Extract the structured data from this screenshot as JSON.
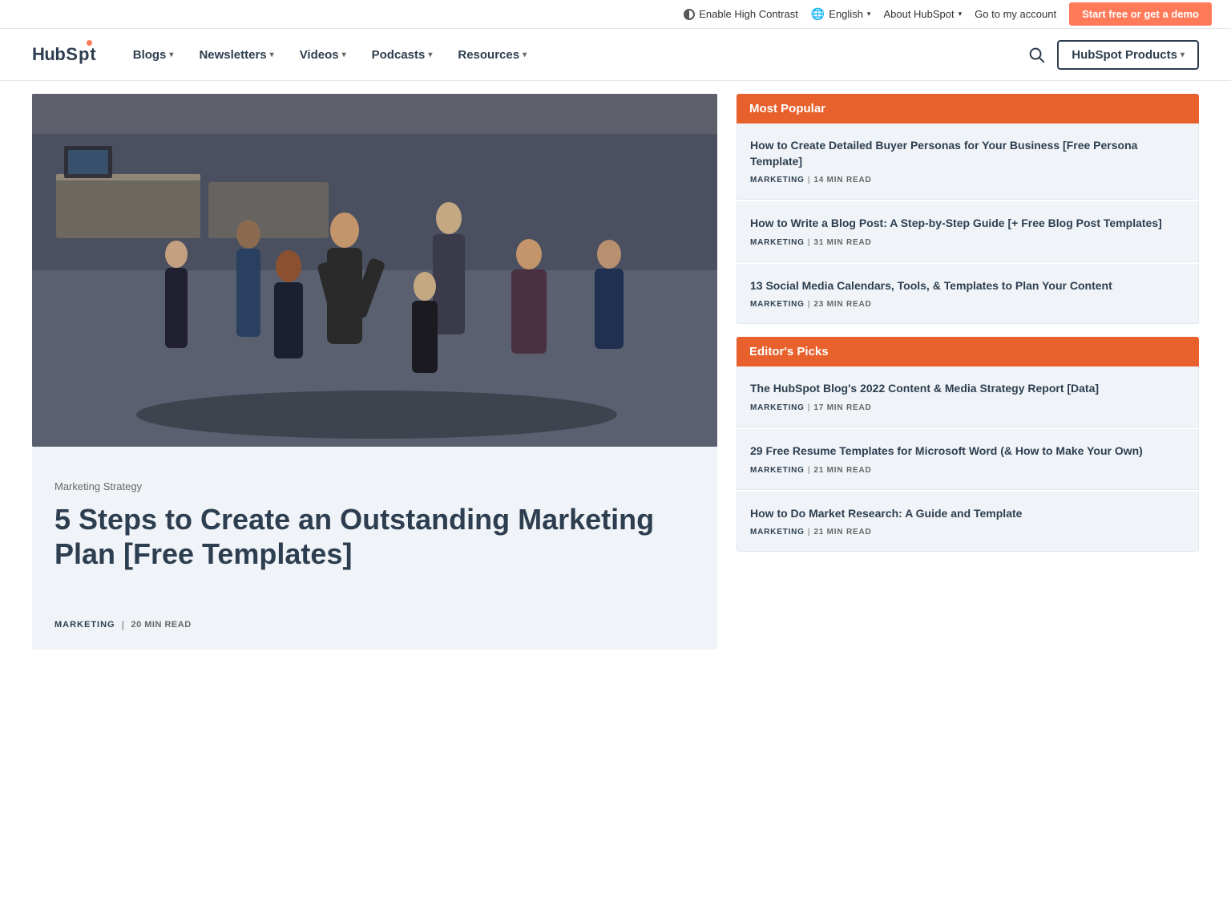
{
  "topbar": {
    "contrast_label": "Enable High Contrast",
    "language_label": "English",
    "about_label": "About HubSpot",
    "account_label": "Go to my account",
    "cta_label": "Start free or get a demo"
  },
  "nav": {
    "logo_text": "HubSpot",
    "links": [
      {
        "label": "Blogs",
        "has_dropdown": true
      },
      {
        "label": "Newsletters",
        "has_dropdown": true
      },
      {
        "label": "Videos",
        "has_dropdown": true
      },
      {
        "label": "Podcasts",
        "has_dropdown": true
      },
      {
        "label": "Resources",
        "has_dropdown": true
      }
    ],
    "search_label": "Search",
    "products_label": "HubSpot Products"
  },
  "article": {
    "category": "Marketing Strategy",
    "title": "5 Steps to Create an Outstanding Marketing Plan [Free Templates]",
    "meta_tag": "MARKETING",
    "meta_read": "20 MIN READ"
  },
  "sidebar": {
    "most_popular": {
      "header": "Most Popular",
      "items": [
        {
          "title": "How to Create Detailed Buyer Personas for Your Business [Free Persona Template]",
          "tag": "MARKETING",
          "read": "14 MIN READ"
        },
        {
          "title": "How to Write a Blog Post: A Step-by-Step Guide [+ Free Blog Post Templates]",
          "tag": "MARKETING",
          "read": "31 MIN READ"
        },
        {
          "title": "13 Social Media Calendars, Tools, & Templates to Plan Your Content",
          "tag": "MARKETING",
          "read": "23 MIN READ"
        }
      ]
    },
    "editors_picks": {
      "header": "Editor's Picks",
      "items": [
        {
          "title": "The HubSpot Blog's 2022 Content & Media Strategy Report [Data]",
          "tag": "MARKETING",
          "read": "17 MIN READ"
        },
        {
          "title": "29 Free Resume Templates for Microsoft Word (& How to Make Your Own)",
          "tag": "MARKETING",
          "read": "21 MIN READ"
        },
        {
          "title": "How to Do Market Research: A Guide and Template",
          "tag": "MARKETING",
          "read": "21 MIN READ"
        }
      ]
    }
  }
}
